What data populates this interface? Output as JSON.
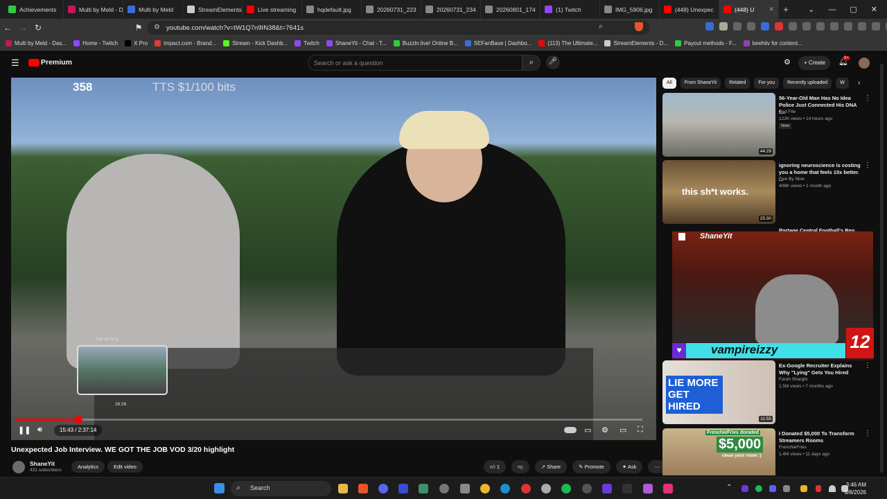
{
  "browser": {
    "tabs": [
      {
        "label": "Achievements",
        "color": "#2ecc40"
      },
      {
        "label": "Multi by Meld - Dash",
        "color": "#c2185b"
      },
      {
        "label": "Multi by Meld",
        "color": "#3a6bd6"
      },
      {
        "label": "StreamElements",
        "color": "#cccccc"
      },
      {
        "label": "Live streaming",
        "color": "#ff0000"
      },
      {
        "label": "hqdefault.jpg",
        "color": "#888888"
      },
      {
        "label": "20260731_223",
        "color": "#888888"
      },
      {
        "label": "20260731_234",
        "color": "#888888"
      },
      {
        "label": "20260801_174",
        "color": "#888888"
      },
      {
        "label": "(1) Twitch",
        "color": "#9146ff"
      },
      {
        "label": "IMG_5906.jpg",
        "color": "#888888"
      },
      {
        "label": "(448) Unexpec",
        "color": "#ff0000"
      },
      {
        "label": "(448) U",
        "color": "#ff0000"
      }
    ],
    "url": "youtube.com/watch?v=tW1Q7n9IN38&t=7641s",
    "bookmarks": [
      {
        "label": "Multi by Meld - Das...",
        "color": "#c2185b"
      },
      {
        "label": "Home - Twitch",
        "color": "#9146ff"
      },
      {
        "label": "X Pro",
        "color": "#000000"
      },
      {
        "label": "impact.com - Brand...",
        "color": "#e53935"
      },
      {
        "label": "Stream - Kick Dashb...",
        "color": "#53fc18"
      },
      {
        "label": "Twitch",
        "color": "#9146ff"
      },
      {
        "label": "ShaneYit - Chat - T...",
        "color": "#9146ff"
      },
      {
        "label": "Buzzln.live! Online B...",
        "color": "#2ecc40"
      },
      {
        "label": "SEFanBase | Dashbo...",
        "color": "#3a6bd6"
      },
      {
        "label": "(113) The Ultimate...",
        "color": "#ff0000"
      },
      {
        "label": "StreamElements - D...",
        "color": "#cccccc"
      },
      {
        "label": "Payout methods - F...",
        "color": "#2ecc40"
      },
      {
        "label": "beehiiv for content...",
        "color": "#8e44ad"
      }
    ]
  },
  "youtube": {
    "logo": "Premium",
    "search_placeholder": "Search or ask a question",
    "create_label": "+ Create",
    "notif_count": "9+"
  },
  "video": {
    "overlay_count": "358",
    "overlay_tts": "TTS $1/100 bits",
    "preview_caption": "Pull up for p...",
    "preview_chapter": "26:26",
    "time": "15:43 / 2:37:14",
    "progress": 0.1,
    "title": "Unexpected Job Interview. WE GOT THE JOB VOD 3/20 highlight",
    "channel": "ShaneYit",
    "subscribers": "431 subscribers",
    "analytics_label": "Analytics",
    "edit_label": "Edit video",
    "likes": "1",
    "share_label": "Share",
    "promote_label": "Promote",
    "ask_label": "Ask"
  },
  "sidebar": {
    "chips": [
      "All",
      "From ShaneYit",
      "Related",
      "For you",
      "Recently uploaded",
      "W"
    ],
    "recs": [
      {
        "title": "56-Year-Old Man Has No Idea Police Just Connected His DNA t...",
        "channel": "Red File",
        "meta": "122K views • 14 hours ago",
        "badge": "New",
        "duration": "44:29"
      },
      {
        "title": "ignoring neuroscience is costing you a home that feels 10x better. ...",
        "channel": "Five By Nine",
        "meta": "408K views • 1 month ago",
        "duration": "25:30",
        "thumb_text": "this sh*t works."
      },
      {
        "title": "Ex-Google Recruiter Explains Why \"Lying\" Gets You Hired",
        "channel": "Farah Sharghi",
        "meta": "1.5M views • 7 months ago",
        "duration": "11:55",
        "thumb_text": "LIE MORE GET HIRED"
      },
      {
        "title": "I Donated $5,000 To Transform Streamers Rooms",
        "channel": "FrenchieFries",
        "meta": "1.4M views • 11 days ago",
        "thumb_text": "$5,000",
        "thumb_sub": "clean your room :)",
        "thumb_top": "FrenchieFries donated"
      }
    ],
    "partial_title": "Portage Central Football's Ren..."
  },
  "twitch_overlay": {
    "name": "ShaneYit",
    "username": "vampireizzy",
    "number": "12"
  },
  "taskbar": {
    "search": "Search",
    "time": "3:46 AM",
    "date": "8/8/2026"
  }
}
